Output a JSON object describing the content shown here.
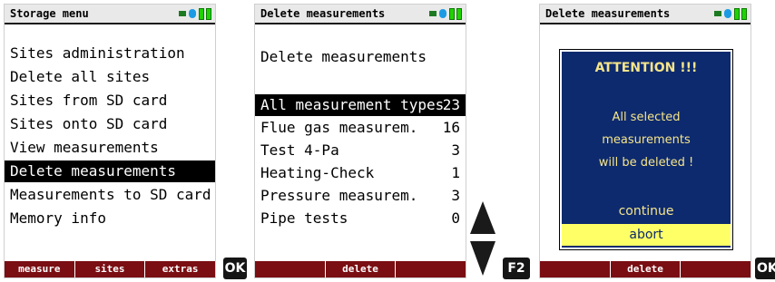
{
  "screen1": {
    "title": "Storage menu",
    "items": [
      "Sites administration",
      "Delete all sites",
      "Sites from SD card",
      "Sites onto SD card",
      "View measurements",
      "Delete measurements",
      "Measurements to SD card",
      "Memory info"
    ],
    "selected_index": 5,
    "softkeys": [
      "measure",
      "sites",
      "extras"
    ]
  },
  "key_ok_1": "OK",
  "screen2": {
    "title": "Delete measurements",
    "heading": "Delete measurements",
    "items": [
      {
        "label": "All measurement types",
        "count": "23"
      },
      {
        "label": "Flue gas measurem.",
        "count": "16"
      },
      {
        "label": "Test 4-Pa",
        "count": "3"
      },
      {
        "label": "Heating-Check",
        "count": "1"
      },
      {
        "label": "Pressure measurem.",
        "count": "3"
      },
      {
        "label": "Pipe tests",
        "count": "0"
      }
    ],
    "selected_index": 0,
    "softkeys": [
      "",
      "delete",
      ""
    ]
  },
  "key_f2": "F2",
  "screen3": {
    "title": "Delete measurements",
    "dialog": {
      "title": "ATTENTION !!!",
      "message_lines": [
        "All selected",
        "measurements",
        "will be deleted !"
      ],
      "continue_label": "continue",
      "abort_label": "abort"
    },
    "softkeys": [
      "",
      "delete",
      ""
    ]
  },
  "key_ok_2": "OK",
  "colors": {
    "softkey_bar": "#7a0e13",
    "dialog_bg": "#0d2a6e",
    "dialog_text": "#f6e58a",
    "abort_highlight": "#ffff66",
    "selection": "#000000"
  }
}
